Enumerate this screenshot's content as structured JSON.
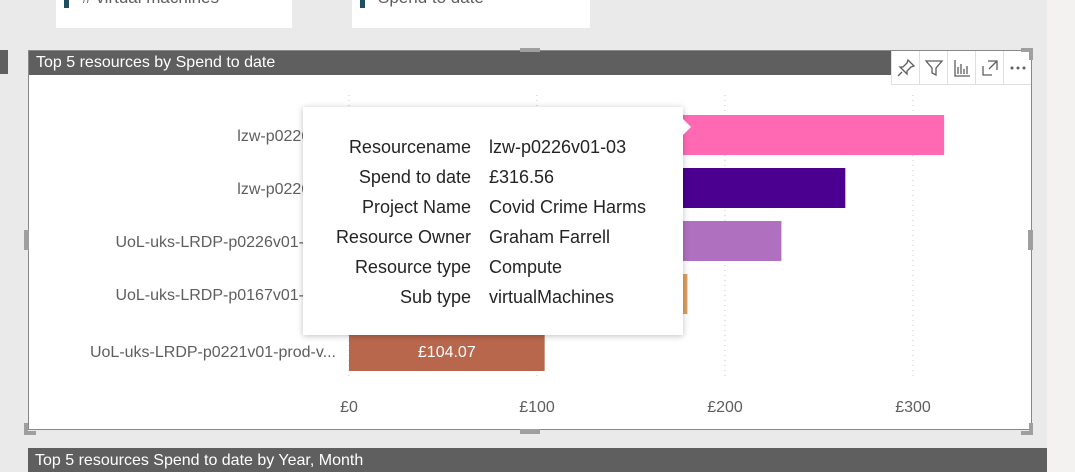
{
  "cards": [
    {
      "label": "# virtual machines"
    },
    {
      "label": "Spend to date"
    }
  ],
  "visual": {
    "title": "Top 5 resources by Spend to date",
    "header_icons": [
      "pin-icon",
      "filter-icon",
      "focus-analytics-icon",
      "expand-icon",
      "more-options-icon"
    ]
  },
  "chart_data": {
    "type": "bar",
    "orientation": "horizontal",
    "title": "Top 5 resources by Spend to date",
    "categories": [
      "lzw-p0226v01-03",
      "lzw-p0226v01",
      "UoL-uks-LRDP-p0226v01-prod",
      "UoL-uks-LRDP-p0167v01-prod",
      "UoL-uks-LRDP-p0221v01-prod-v"
    ],
    "category_labels": [
      "lzw-p0226v01",
      "lzw-p0226v01",
      "UoL-uks-LRDP-p0226v01-prod",
      "UoL-uks-LRDP-p0167v01-prod",
      "UoL-uks-LRDP-p0221v01-prod-v..."
    ],
    "values": [
      316.56,
      264,
      230,
      180,
      104.07
    ],
    "bar_colors": [
      "#ff69b4",
      "#4b0090",
      "#b070c0",
      "#e0a060",
      "#b8674d"
    ],
    "data_labels": [
      "",
      "",
      "",
      "",
      "£104.07"
    ],
    "xlim": [
      0,
      330
    ],
    "x_ticks": [
      0,
      100,
      200,
      300
    ],
    "x_tick_labels": [
      "£0",
      "£100",
      "£200",
      "£300"
    ],
    "grid": true
  },
  "tooltip": {
    "rows": [
      {
        "key": "Resourcename",
        "value": "lzw-p0226v01-03"
      },
      {
        "key": "Spend to date",
        "value": "£316.56"
      },
      {
        "key": "Project Name",
        "value": "Covid Crime Harms"
      },
      {
        "key": "Resource Owner",
        "value": "Graham Farrell"
      },
      {
        "key": "Resource type",
        "value": "Compute"
      },
      {
        "key": "Sub type",
        "value": "virtualMachines"
      }
    ]
  },
  "bottom_visual": {
    "title": "Top 5 resources Spend to date by Year, Month"
  }
}
